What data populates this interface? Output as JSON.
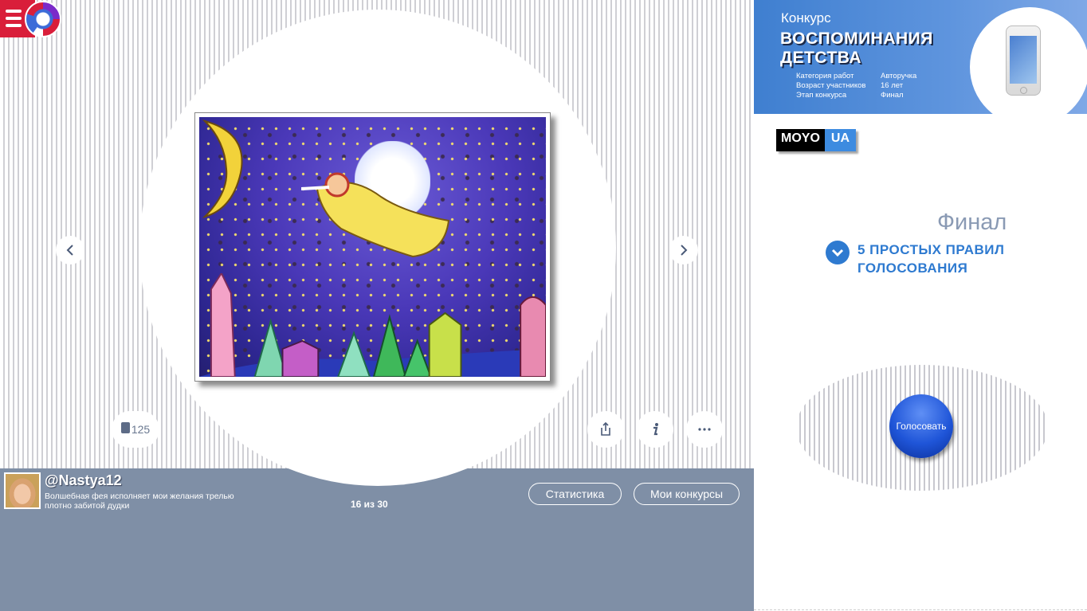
{
  "contest": {
    "label": "Конкурс",
    "title_line1": "ВОСПОМИНАНИЯ",
    "title_line2": "ДЕТСТВА",
    "meta": [
      {
        "key": "Категория работ",
        "value": "Авторучка"
      },
      {
        "key": "Возраст участников",
        "value": "16 лет"
      },
      {
        "key": "Этап конкурса",
        "value": "Финал"
      }
    ]
  },
  "sponsor": {
    "part1": "MOYO",
    "part2": "UA"
  },
  "stage": {
    "title": "Финал"
  },
  "rules": {
    "line1": "5 ПРОСТЫХ ПРАВИЛ",
    "line2": "ГОЛОСОВАНИЯ"
  },
  "vote": {
    "label": "Голосовать"
  },
  "likes": {
    "count": "125"
  },
  "user": {
    "name": "@Nastya12",
    "description": "Волшебная фея исполняет мои желания трелью плотно забитой дудки"
  },
  "pager": {
    "text": "16 из 30"
  },
  "buttons": {
    "stats": "Статистика",
    "my_contests": "Мои конкурсы"
  },
  "icons": {
    "menu": "menu-icon",
    "prev": "chevron-left-icon",
    "next": "chevron-right-icon",
    "share": "share-icon",
    "info": "info-icon",
    "more": "more-icon",
    "like": "bag-icon",
    "check": "check-circle-icon"
  },
  "colors": {
    "banner_blue": "#3f7fd0",
    "menu_red": "#d91e3a",
    "panel_gray_blue": "#7f8fa6",
    "rules_blue": "#2e7ad0",
    "vote_blue": "#1f55d8"
  }
}
